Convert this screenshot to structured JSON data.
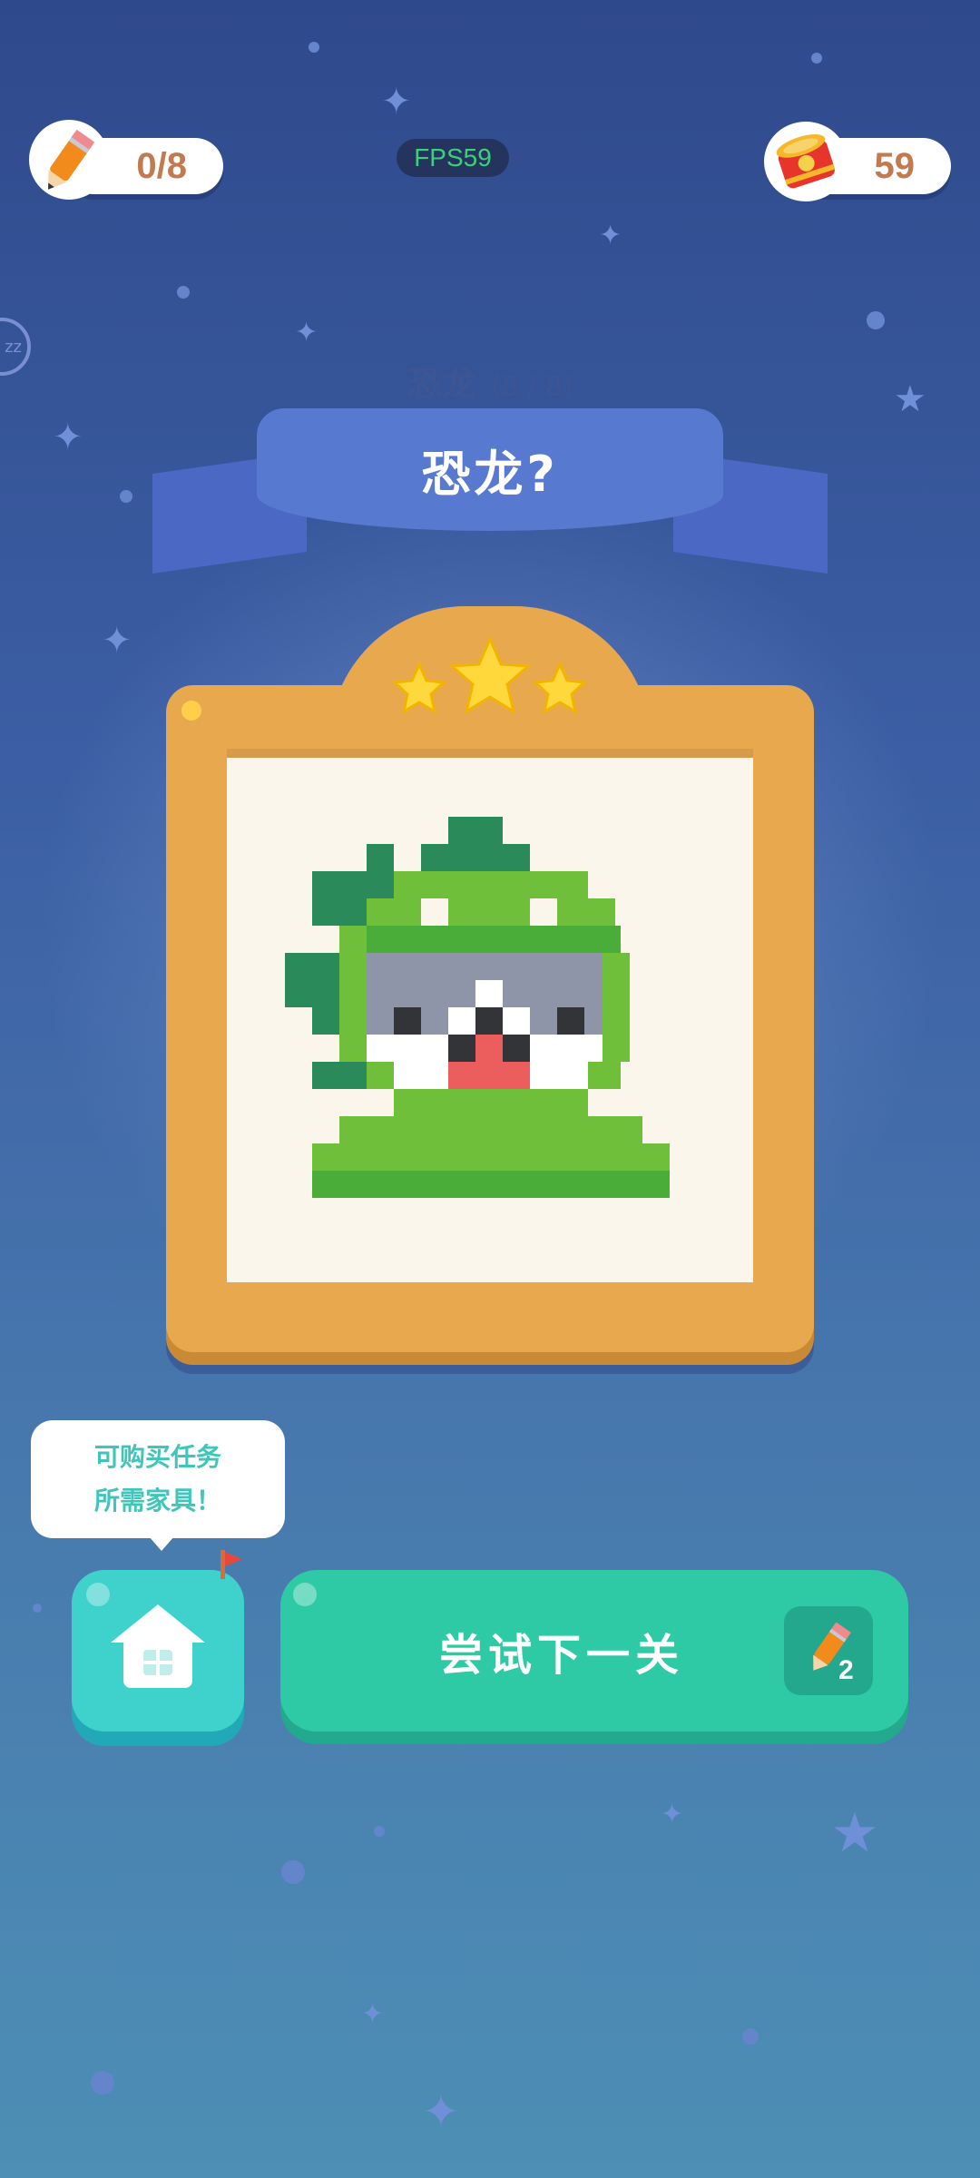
{
  "hud": {
    "pencils": "0/8",
    "coins": "59",
    "fps": "FPS59",
    "sleep_icon": "zz"
  },
  "level": {
    "name": "恐龙",
    "progress": "(8 / 8)",
    "title": "恐龙?",
    "stars_earned": 3,
    "stars_total": 3
  },
  "tip": {
    "line1": "可购买任务",
    "line2": "所需家具！"
  },
  "actions": {
    "next_label": "尝试下一关",
    "next_cost": "2"
  },
  "colors": {
    "frame": "#e8a94e",
    "ribbon": "#5779cf",
    "next_button": "#2ecaa5",
    "home_button": "#3fd2cd",
    "dino_light": "#6fbf3a",
    "dino_dark": "#2a8a5a",
    "face_gray": "#8e95a8",
    "tongue": "#ec5e5e"
  }
}
